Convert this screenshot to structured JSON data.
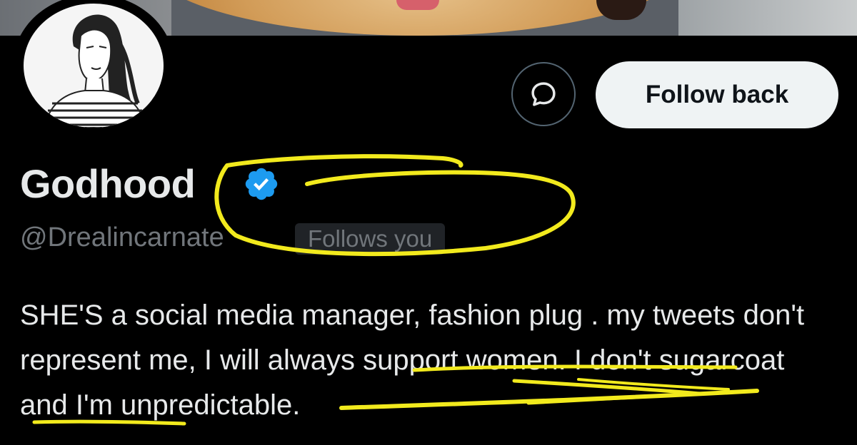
{
  "banner": {
    "image": "golden-retriever-photo"
  },
  "profile": {
    "name": "Godhood",
    "handle": "@Drealincarnate",
    "follows_you_badge": "Follows you",
    "bio": "SHE'S a social media manager, fashion plug . my tweets don't represent me, I will always support women. I don't sugarcoat and I'm unpredictable.",
    "verified": true
  },
  "actions": {
    "message_icon": "message-icon",
    "follow_back_label": "Follow back"
  },
  "colors": {
    "background": "#000000",
    "text_primary": "#e7e9ea",
    "text_secondary": "#71767b",
    "verified_badge": "#1d9bf0",
    "button_light": "#eff3f4",
    "annotation": "#f2ea1d"
  }
}
